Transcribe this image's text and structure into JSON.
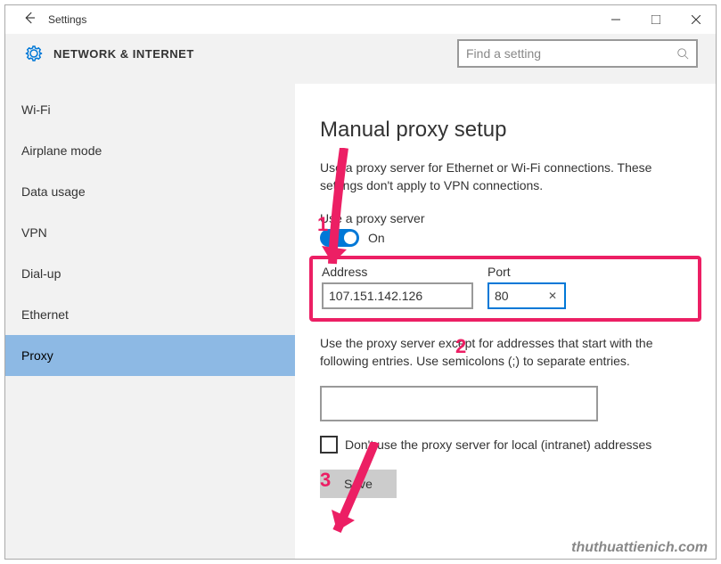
{
  "window": {
    "title": "Settings"
  },
  "header": {
    "category": "NETWORK & INTERNET",
    "search_placeholder": "Find a setting"
  },
  "sidebar": {
    "items": [
      {
        "label": "Wi-Fi",
        "selected": false
      },
      {
        "label": "Airplane mode",
        "selected": false
      },
      {
        "label": "Data usage",
        "selected": false
      },
      {
        "label": "VPN",
        "selected": false
      },
      {
        "label": "Dial-up",
        "selected": false
      },
      {
        "label": "Ethernet",
        "selected": false
      },
      {
        "label": "Proxy",
        "selected": true
      }
    ]
  },
  "main": {
    "heading": "Manual proxy setup",
    "description": "Use a proxy server for Ethernet or Wi-Fi connections. These settings don't apply to VPN connections.",
    "toggle_label": "Use a proxy server",
    "toggle_state": "On",
    "address_label": "Address",
    "address_value": "107.151.142.126",
    "port_label": "Port",
    "port_value": "80",
    "exceptions_label": "Use the proxy server except for addresses that start with the following entries. Use semicolons (;) to separate entries.",
    "exceptions_value": "",
    "local_bypass_label": "Don't use the proxy server for local (intranet) addresses",
    "local_bypass_checked": false,
    "save_label": "Save"
  },
  "annotations": {
    "step1": "1",
    "step2": "2",
    "step3": "3"
  },
  "watermark": "thuthuattienich.com"
}
